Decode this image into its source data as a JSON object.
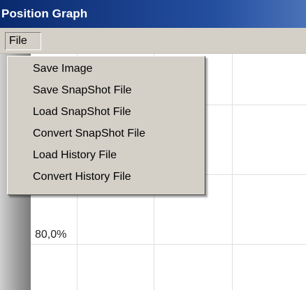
{
  "window": {
    "title": "Position Graph"
  },
  "menubar": {
    "file_label": "File"
  },
  "file_menu": {
    "items": [
      {
        "label": "Save Image"
      },
      {
        "label": "Save SnapShot File"
      },
      {
        "label": "Load SnapShot File"
      },
      {
        "label": "Convert SnapShot File"
      },
      {
        "label": "Load History File"
      },
      {
        "label": "Convert History File"
      }
    ]
  },
  "graph": {
    "y_tick_label": "80,0%"
  },
  "colors": {
    "titlebar": "#0a2a6e",
    "menu_background": "#d4d0c8",
    "plot_background": "#ffffff"
  }
}
